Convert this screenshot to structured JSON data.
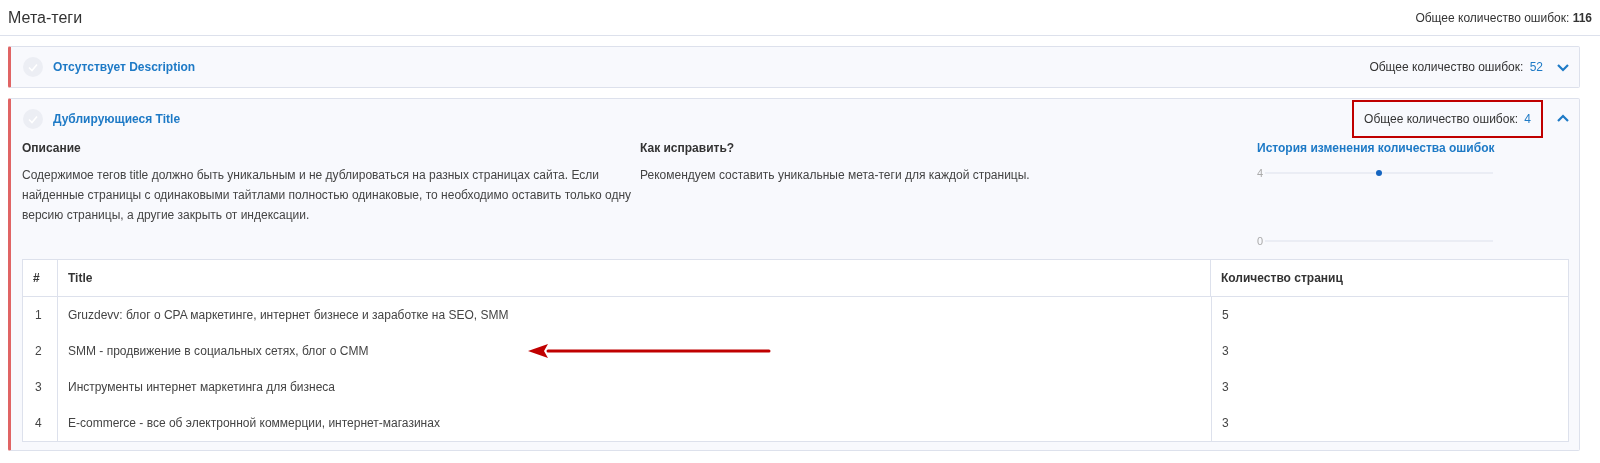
{
  "page": {
    "title": "Мета-теги",
    "total_label": "Общее количество ошибок:",
    "total_value": "116"
  },
  "sections": [
    {
      "title": "Отсутствует Description",
      "count_label": "Общее количество ошибок:",
      "count_value": "52",
      "expanded": false,
      "highlighted": false
    },
    {
      "title": "Дублирующиеся Title",
      "count_label": "Общее количество ошибок:",
      "count_value": "4",
      "expanded": true,
      "highlighted": true,
      "description_heading": "Описание",
      "description": "Содержимое тегов title должно быть уникальным и не дублироваться на разных страницах сайта. Если найденные страницы с одинаковыми тайтлами полностью одинаковые, то необходимо оставить только одну версию страницы, а другие закрыть от индексации.",
      "fix_heading": "Как исправить?",
      "fix": "Рекомендуем составить уникальные мета-теги для каждой страницы.",
      "chart_data": {
        "type": "line",
        "title": "История изменения количества ошибок",
        "categories": [
          null,
          null,
          null
        ],
        "series": [
          {
            "color": "#1565c0",
            "marker": true,
            "values": [
              null,
              4,
              null
            ]
          }
        ],
        "ylim": [
          0,
          4
        ],
        "yticks": [
          0,
          4
        ]
      },
      "table": {
        "columns": [
          "#",
          "Title",
          "Количество страниц"
        ],
        "rows": [
          {
            "num": "1",
            "title": "Gruzdevv: блог о CPA маркетинге, интернет бизнесе и заработке на SEO, SMM",
            "pages": "5",
            "arrow": false
          },
          {
            "num": "2",
            "title": "SMM - продвижение в социальных сетях, блог о CMM",
            "pages": "3",
            "arrow": true
          },
          {
            "num": "3",
            "title": "Инструменты интернет маркетинга для бизнеса",
            "pages": "3",
            "arrow": false
          },
          {
            "num": "4",
            "title": "E-commerce - все об электронной коммерции, интернет-магазинах",
            "pages": "3",
            "arrow": false
          }
        ]
      }
    }
  ]
}
